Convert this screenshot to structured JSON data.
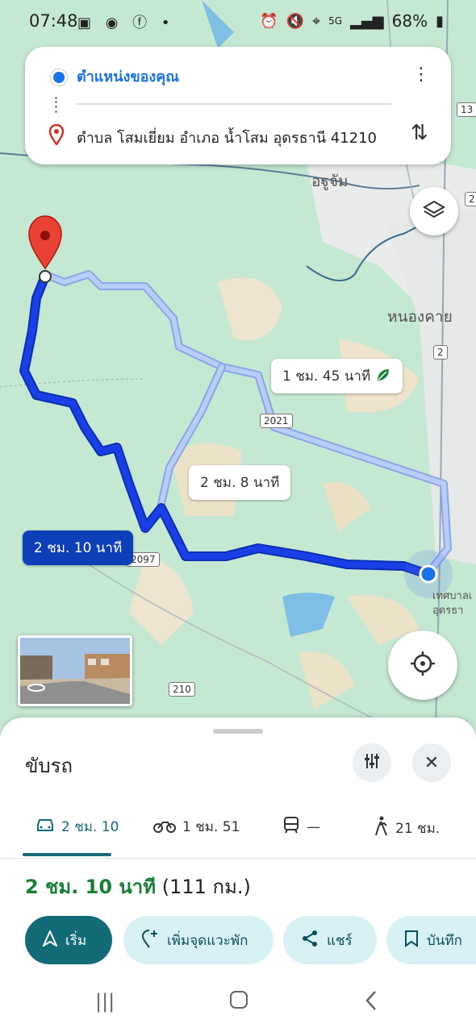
{
  "status_bar": {
    "time": "07:48",
    "battery": "68%",
    "network": "5G"
  },
  "search": {
    "origin": "ตำแหน่งของคุณ",
    "destination": "ตำบล โสมเยี่ยม อำเภอ น้ำโสม อุดรธานี 41210"
  },
  "map": {
    "place_labels": [
      "อฐูจัม",
      "หนองคาย",
      "เทศบาลเ",
      "อุดรธา"
    ],
    "road_shields": [
      "13",
      "2",
      "2",
      "2021",
      "2097",
      "210"
    ],
    "route_labels": {
      "selected": "2 ชม. 10 นาที",
      "alt1": "1 ชม. 45 นาที",
      "alt2": "2 ชม. 8 นาที"
    },
    "eco_icon": "leaf-icon"
  },
  "sheet": {
    "title": "ขับรถ",
    "tabs": [
      {
        "icon": "car-icon",
        "label": "2 ชม. 10"
      },
      {
        "icon": "motorcycle-icon",
        "label": "1 ชม. 51"
      },
      {
        "icon": "transit-icon",
        "label": "—"
      },
      {
        "icon": "walk-icon",
        "label": "21 ชม."
      }
    ],
    "summary_duration": "2 ชม. 10 นาที",
    "summary_distance": "(111 กม.)",
    "actions": {
      "start": "เริ่ม",
      "add_stop": "เพิ่มจุดแวะพัก",
      "share": "แชร์",
      "save": "บันทึก"
    }
  },
  "colors": {
    "route_main": "#1a3fe6",
    "route_alt": "#a8c3f5",
    "accent": "#146b78",
    "duration_green": "#188038"
  }
}
